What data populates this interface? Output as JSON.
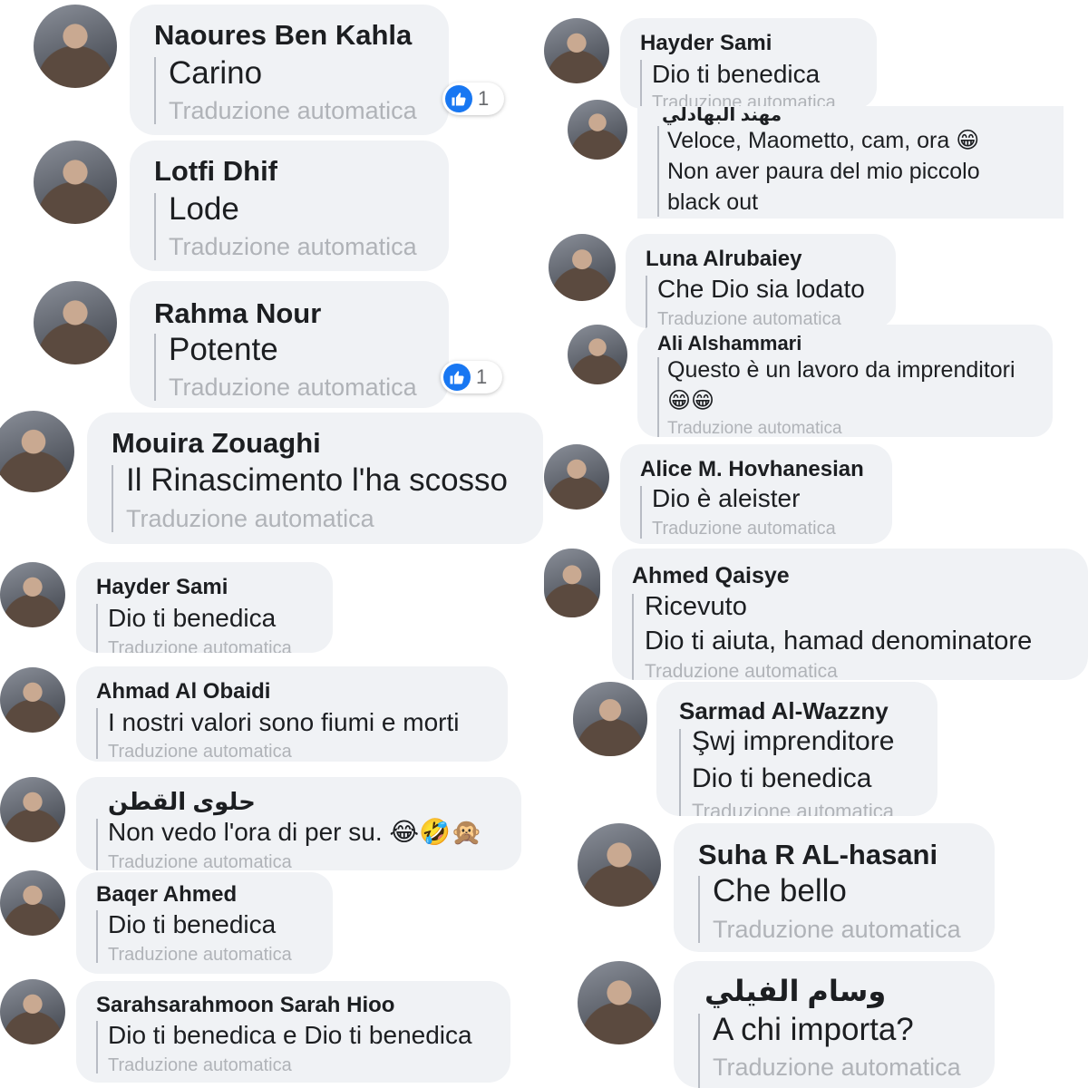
{
  "translate_label": "Traduzione automatica",
  "comments": {
    "c1": {
      "name": "Naoures Ben Kahla",
      "text": "Carino",
      "likes": "1"
    },
    "c2": {
      "name": "Lotfi Dhif",
      "text": "Lode"
    },
    "c3": {
      "name": "Rahma Nour",
      "text": "Potente",
      "likes": "1"
    },
    "c4": {
      "name": "Mouira Zouaghi",
      "text": "Il Rinascimento l'ha scosso"
    },
    "c5": {
      "name": "Hayder Sami",
      "text": "Dio ti benedica"
    },
    "c6": {
      "name": "Ahmad Al Obaidi",
      "text": "I nostri valori sono fiumi e morti"
    },
    "c7": {
      "name": "حلوى القطن",
      "text": "Non vedo l'ora di per su. 😂🤣🙊"
    },
    "c8": {
      "name": "Baqer Ahmed",
      "text": "Dio ti benedica"
    },
    "c9": {
      "name": "Sarahsarahmoon Sarah Hioo",
      "text": "Dio ti benedica e Dio ti benedica"
    },
    "r1": {
      "name": "Hayder Sami",
      "text": "Dio ti benedica"
    },
    "r2": {
      "name": "مهند البهادلي",
      "text1": "Veloce, Maometto, cam, ora 😁",
      "text2": "Non aver paura del mio piccolo",
      "text3": "black out"
    },
    "r3": {
      "name": "Luna Alrubaiey",
      "text": "Che Dio sia lodato"
    },
    "r4": {
      "name": "Ali Alshammari",
      "text1": "Questo è un lavoro da imprenditori",
      "text2": "😁😁"
    },
    "r5": {
      "name": "Alice M. Hovhanesian",
      "text": "Dio è aleister"
    },
    "r6": {
      "name": "Ahmed Qaisye",
      "text1": "Ricevuto",
      "text2": "Dio ti aiuta, hamad denominatore"
    },
    "r7": {
      "name": "Sarmad Al-Wazzny",
      "text1": "Şwj imprenditore",
      "text2": "Dio ti benedica"
    },
    "r8": {
      "name": "Suha R AL-hasani",
      "text": "Che bello"
    },
    "r9": {
      "name": "وسام الفيلي",
      "text": "A chi importa?"
    }
  }
}
